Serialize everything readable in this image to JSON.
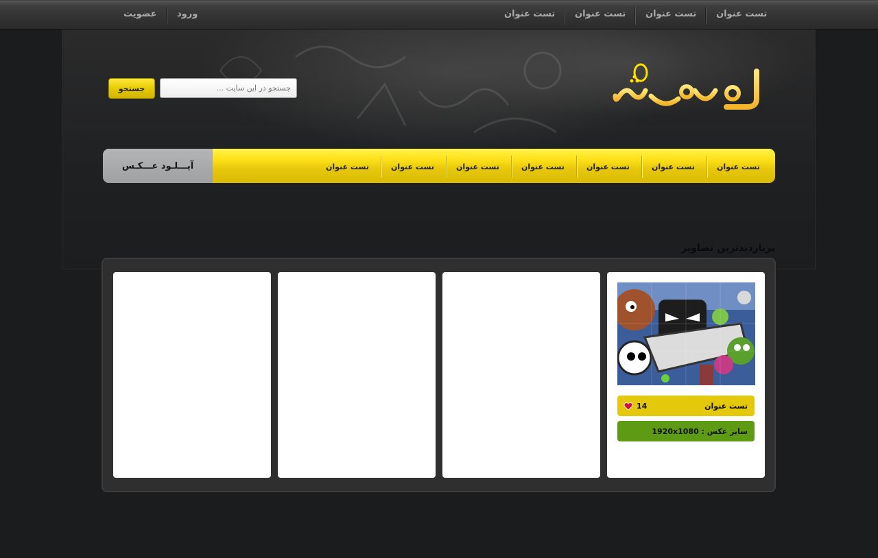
{
  "topnav": {
    "links": [
      "تست عنوان",
      "تست عنوان",
      "تست عنوان",
      "تست عنوان"
    ],
    "login": "ورود",
    "register": "عضویت"
  },
  "logo": {
    "alt": "لوگوی شما"
  },
  "search": {
    "placeholder": "جستجو در این سایت ...",
    "button": "جستجو"
  },
  "mainnav": {
    "items": [
      "تست عنوان",
      "تست عنوان",
      "تست عنوان",
      "تست عنوان",
      "تست عنوان",
      "تست عنوان",
      "تست عنوان"
    ],
    "upload": "آپـــلـود عـــکـس"
  },
  "section": {
    "title": "پربازدیدترین تصاویر"
  },
  "cards": [
    {
      "title": "تست عنوان",
      "likes": "14",
      "size": "سایز عکس : 1920x1080"
    }
  ],
  "colors": {
    "accent": "#e3c80b",
    "green": "#5f9a14",
    "heart": "#d0103a",
    "background": "#1b1c1e"
  }
}
